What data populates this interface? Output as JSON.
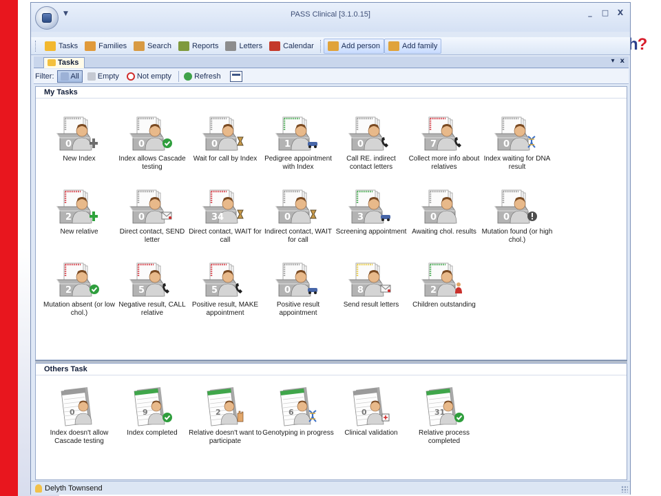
{
  "slide": {
    "title_fragment": "h",
    "title_mark": "?"
  },
  "window": {
    "title": "PASS Clinical [3.1.0.15]",
    "minimize": "_",
    "maximize": "□",
    "close": "X"
  },
  "toolbar": {
    "items": [
      {
        "label": "Tasks",
        "icon": "tasks-icon",
        "color": "#f2b82f"
      },
      {
        "label": "Families",
        "icon": "families-icon",
        "color": "#e09a3a"
      },
      {
        "label": "Search",
        "icon": "search-icon",
        "color": "#d89a42"
      },
      {
        "label": "Reports",
        "icon": "reports-icon",
        "color": "#7f9a3c"
      },
      {
        "label": "Letters",
        "icon": "letters-icon",
        "color": "#8d8d8d"
      },
      {
        "label": "Calendar",
        "icon": "calendar-icon",
        "color": "#c43a2a"
      },
      {
        "label": "Add person",
        "icon": "add-person-icon",
        "color": "#e0a33a"
      },
      {
        "label": "Add family",
        "icon": "add-family-icon",
        "color": "#e0a33a"
      }
    ]
  },
  "tabs": {
    "active": "Tasks",
    "pin": "▾",
    "close": "x"
  },
  "filter": {
    "label": "Filter:",
    "all": "All",
    "empty": "Empty",
    "not_empty": "Not empty",
    "refresh": "Refresh"
  },
  "my_tasks": {
    "title": "My Tasks",
    "items": [
      {
        "count": "0",
        "label": "New Index",
        "accent": "#9a9a9a",
        "badge": "plus"
      },
      {
        "count": "0",
        "label": "Index allows Cascade testing",
        "accent": "#9a9a9a",
        "badge": "check"
      },
      {
        "count": "0",
        "label": "Wait for call by Index",
        "accent": "#9a9a9a",
        "badge": "hourglass"
      },
      {
        "count": "1",
        "label": "Pedigree appointment with Index",
        "accent": "#3fa64a",
        "badge": "car"
      },
      {
        "count": "0",
        "label": "Call RE. indirect contact letters",
        "accent": "#9a9a9a",
        "badge": "phone"
      },
      {
        "count": "7",
        "label": "Collect more info about relatives",
        "accent": "#d3333d",
        "badge": "phone"
      },
      {
        "count": "0",
        "label": "Index waiting for DNA result",
        "accent": "#9a9a9a",
        "badge": "dna"
      },
      {
        "count": "2",
        "label": "New relative",
        "accent": "#d3333d",
        "badge": "plus-green"
      },
      {
        "count": "0",
        "label": "Direct contact, SEND letter",
        "accent": "#9a9a9a",
        "badge": "letter"
      },
      {
        "count": "34",
        "label": "Direct contact, WAIT for call",
        "accent": "#d3333d",
        "badge": "hourglass"
      },
      {
        "count": "0",
        "label": "Indirect contact, WAIT for call",
        "accent": "#9a9a9a",
        "badge": "hourglass"
      },
      {
        "count": "3",
        "label": "Screening appointment",
        "accent": "#3fa64a",
        "badge": "car"
      },
      {
        "count": "0",
        "label": "Awaiting chol. results",
        "accent": "#9a9a9a",
        "badge": "none"
      },
      {
        "count": "0",
        "label": "Mutation found (or high chol.)",
        "accent": "#9a9a9a",
        "badge": "alert"
      },
      {
        "count": "2",
        "label": "Mutation absent (or low chol.)",
        "accent": "#d3333d",
        "badge": "check"
      },
      {
        "count": "5",
        "label": "Negative result, CALL relative",
        "accent": "#d3333d",
        "badge": "phone"
      },
      {
        "count": "5",
        "label": "Positive result, MAKE appointment",
        "accent": "#d3333d",
        "badge": "phone"
      },
      {
        "count": "0",
        "label": "Positive result appointment",
        "accent": "#9a9a9a",
        "badge": "car"
      },
      {
        "count": "8",
        "label": "Send result letters",
        "accent": "#e8c93a",
        "badge": "letter"
      },
      {
        "count": "2",
        "label": "Children outstanding",
        "accent": "#3fa64a",
        "badge": "child"
      }
    ]
  },
  "others_task": {
    "title": "Others Task",
    "items": [
      {
        "count": "0",
        "label": "Index doesn't allow Cascade testing",
        "accent": "#9a9a9a",
        "badge": "none"
      },
      {
        "count": "9",
        "label": "Index completed",
        "accent": "#3fa64a",
        "badge": "check"
      },
      {
        "count": "2",
        "label": "Relative doesn't want to participate",
        "accent": "#3fa64a",
        "badge": "stop"
      },
      {
        "count": "6",
        "label": "Genotyping in progress",
        "accent": "#3fa64a",
        "badge": "dna"
      },
      {
        "count": "0",
        "label": "Clinical validation",
        "accent": "#9a9a9a",
        "badge": "doctor"
      },
      {
        "count": "31",
        "label": "Relative process completed",
        "accent": "#3fa64a",
        "badge": "check"
      }
    ]
  },
  "status": {
    "user": "Delyth Townsend"
  }
}
